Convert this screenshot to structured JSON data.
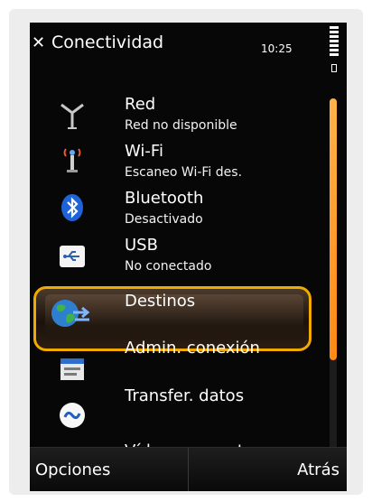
{
  "header": {
    "title": "Conectividad",
    "time": "10:25",
    "close_icon": "close-icon"
  },
  "items": [
    {
      "label": "Red",
      "sub": "Red no disponible",
      "icon": "antenna-icon"
    },
    {
      "label": "Wi-Fi",
      "sub": "Escaneo Wi-Fi des.",
      "icon": "wifi-antenna-icon"
    },
    {
      "label": "Bluetooth",
      "sub": "Desactivado",
      "icon": "bluetooth-icon"
    },
    {
      "label": "USB",
      "sub": "No conectado",
      "icon": "usb-icon"
    },
    {
      "label": "Destinos",
      "sub": "",
      "icon": "globe-icon",
      "selected": true
    },
    {
      "label": "Admin. conexión",
      "sub": "",
      "icon": "connection-manager-icon"
    },
    {
      "label": "Transfer. datos",
      "sub": "",
      "icon": "transfer-icon"
    },
    {
      "label": "Vídeo compart.",
      "sub": "",
      "icon": "video-share-icon"
    }
  ],
  "softkeys": {
    "left": "Opciones",
    "right": "Atrás"
  },
  "colors": {
    "highlight_border": "#f2a900",
    "scroll_thumb": "#ff9a26",
    "background": "#070707"
  }
}
